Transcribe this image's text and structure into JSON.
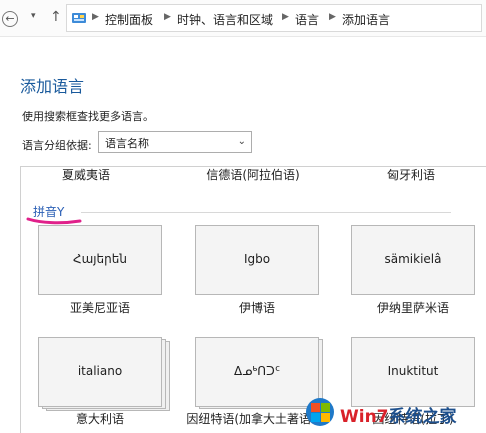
{
  "address_bar": {
    "breadcrumbs": [
      "控制面板",
      "时钟、语言和区域",
      "语言",
      "添加语言"
    ]
  },
  "page": {
    "title": "添加语言",
    "hint": "使用搜索框查找更多语言。",
    "group_by_label": "语言分组依据:",
    "group_by_value": "语言名称"
  },
  "previous_row": [
    "夏威夷语",
    "信德语(阿拉伯语)",
    "匈牙利语"
  ],
  "section": {
    "label": "拼音Y"
  },
  "languages": [
    {
      "native": "Հայերեն",
      "name": "亚美尼亚语"
    },
    {
      "native": "Igbo",
      "name": "伊博语"
    },
    {
      "native": "sämikielâ",
      "name": "伊纳里萨米语"
    },
    {
      "native": "italiano",
      "name": "意大利语"
    },
    {
      "native": "ᐃᓄᒃᑎᑐᑦ",
      "name": "因纽特语(加拿大土著语节)"
    },
    {
      "native": "Inuktitut",
      "name": "因纽特语(拉丁)"
    }
  ],
  "watermark": {
    "brand_a": "Win7",
    "brand_b": "系统之家"
  },
  "colors": {
    "title": "#1a5a9c",
    "section": "#2a5fb5",
    "marker": "#e0208a"
  },
  "icons": [
    "back-arrow-icon",
    "dropdown-icon",
    "up-arrow-icon",
    "control-panel-icon",
    "breadcrumb-chevron-icon",
    "select-chevron-icon",
    "windows-logo-icon"
  ]
}
